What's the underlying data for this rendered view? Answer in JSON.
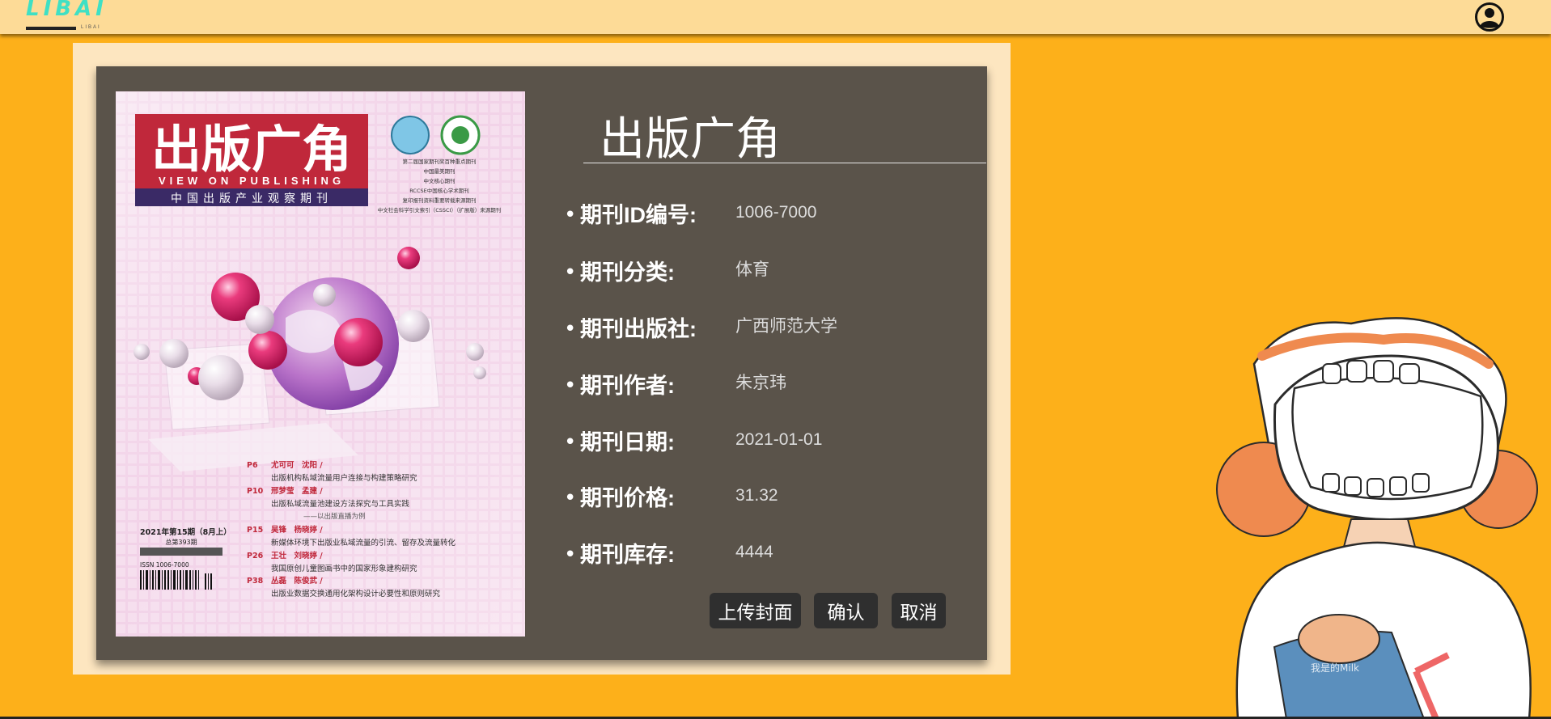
{
  "header": {
    "logo_text": "LIBAI",
    "logo_sub": "LIBAI",
    "user_icon": "user-circle-icon"
  },
  "cover": {
    "masthead": "出版广角",
    "masthead_en": "VIEW ON PUBLISHING",
    "subtitle": "中国出版产业观察期刊",
    "issue": "2021年第15期（8月上）",
    "total_issue": "总第393期",
    "issn": "ISSN 1006-7000",
    "badges": [
      "第二届国家期刊奖百种重点期刊",
      "中国最美期刊",
      "中文核心期刊",
      "RCCSE中国核心学术期刊",
      "复印报刊资料重要转载来源期刊",
      "中文社会科学引文索引（CSSCI）（扩展版）来源期刊"
    ],
    "contents": [
      {
        "page": "P6",
        "authors": "尤可可　沈阳 /",
        "title": "出版机构私域流量用户连接与构建策略研究"
      },
      {
        "page": "P10",
        "authors": "邢梦莹　孟建 /",
        "title": "出版私域流量池建设方法探究与工具实践",
        "note": "——以出版直播为例"
      },
      {
        "page": "P15",
        "authors": "吴锋　杨晓婷 /",
        "title": "新媒体环境下出版业私域流量的引流、留存及流量转化"
      },
      {
        "page": "P26",
        "authors": "王壮　刘晓婷 /",
        "title": "我国原创儿童图画书中的国家形象建构研究"
      },
      {
        "page": "P38",
        "authors": "丛磊　陈俊武 /",
        "title": "出版业数据交换通用化架构设计必要性和原则研究"
      }
    ]
  },
  "detail": {
    "title": "出版广角",
    "fields": [
      {
        "label": "期刊ID编号:",
        "value": "1006-7000"
      },
      {
        "label": "期刊分类:",
        "value": "体育"
      },
      {
        "label": "期刊出版社:",
        "value": "广西师范大学"
      },
      {
        "label": "期刊作者:",
        "value": "朱京玮"
      },
      {
        "label": "期刊日期:",
        "value": "2021-01-01"
      },
      {
        "label": "期刊价格:",
        "value": "31.32"
      },
      {
        "label": "期刊库存:",
        "value": "4444"
      }
    ]
  },
  "actions": {
    "upload": "上传封面",
    "confirm": "确认",
    "cancel": "取消"
  },
  "mascot": {
    "bag_text": "我是的Milk"
  },
  "colors": {
    "page_bg": "#fdb01a",
    "topbar_bg": "#fddb97",
    "panel_bg": "#fde6c0",
    "card_bg": "#5a534a",
    "button_bg": "#2f2f2f",
    "logo": "#3fe0c4"
  }
}
